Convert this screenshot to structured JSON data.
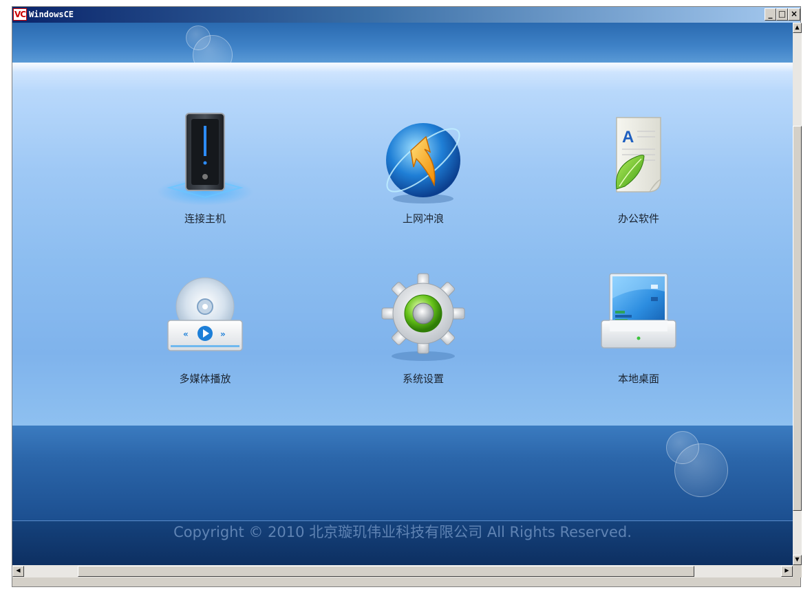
{
  "window": {
    "title": "WindowsCE",
    "app_icon_text": "VC",
    "minimize_glyph": "_",
    "maximize_glyph": "□",
    "close_glyph": "×"
  },
  "tiles": [
    {
      "label": "连接主机",
      "icon": "server-tower-icon"
    },
    {
      "label": "上网冲浪",
      "icon": "globe-arrow-icon"
    },
    {
      "label": "办公软件",
      "icon": "document-leaf-icon"
    },
    {
      "label": "多媒体播放",
      "icon": "media-disc-player-icon"
    },
    {
      "label": "系统设置",
      "icon": "gear-settings-icon"
    },
    {
      "label": "本地桌面",
      "icon": "desktop-monitor-icon"
    }
  ],
  "footer": {
    "copyright": "Copyright © 2010 北京璇玑伟业科技有限公司 All Rights Reserved."
  },
  "scrollbars": {
    "up_arrow": "▲",
    "down_arrow": "▼",
    "left_arrow": "◀",
    "right_arrow": "▶"
  },
  "colors": {
    "titlebar_start": "#0a246a",
    "panel_light": "#b8d8fb",
    "footer_dark": "#0d2f61"
  }
}
